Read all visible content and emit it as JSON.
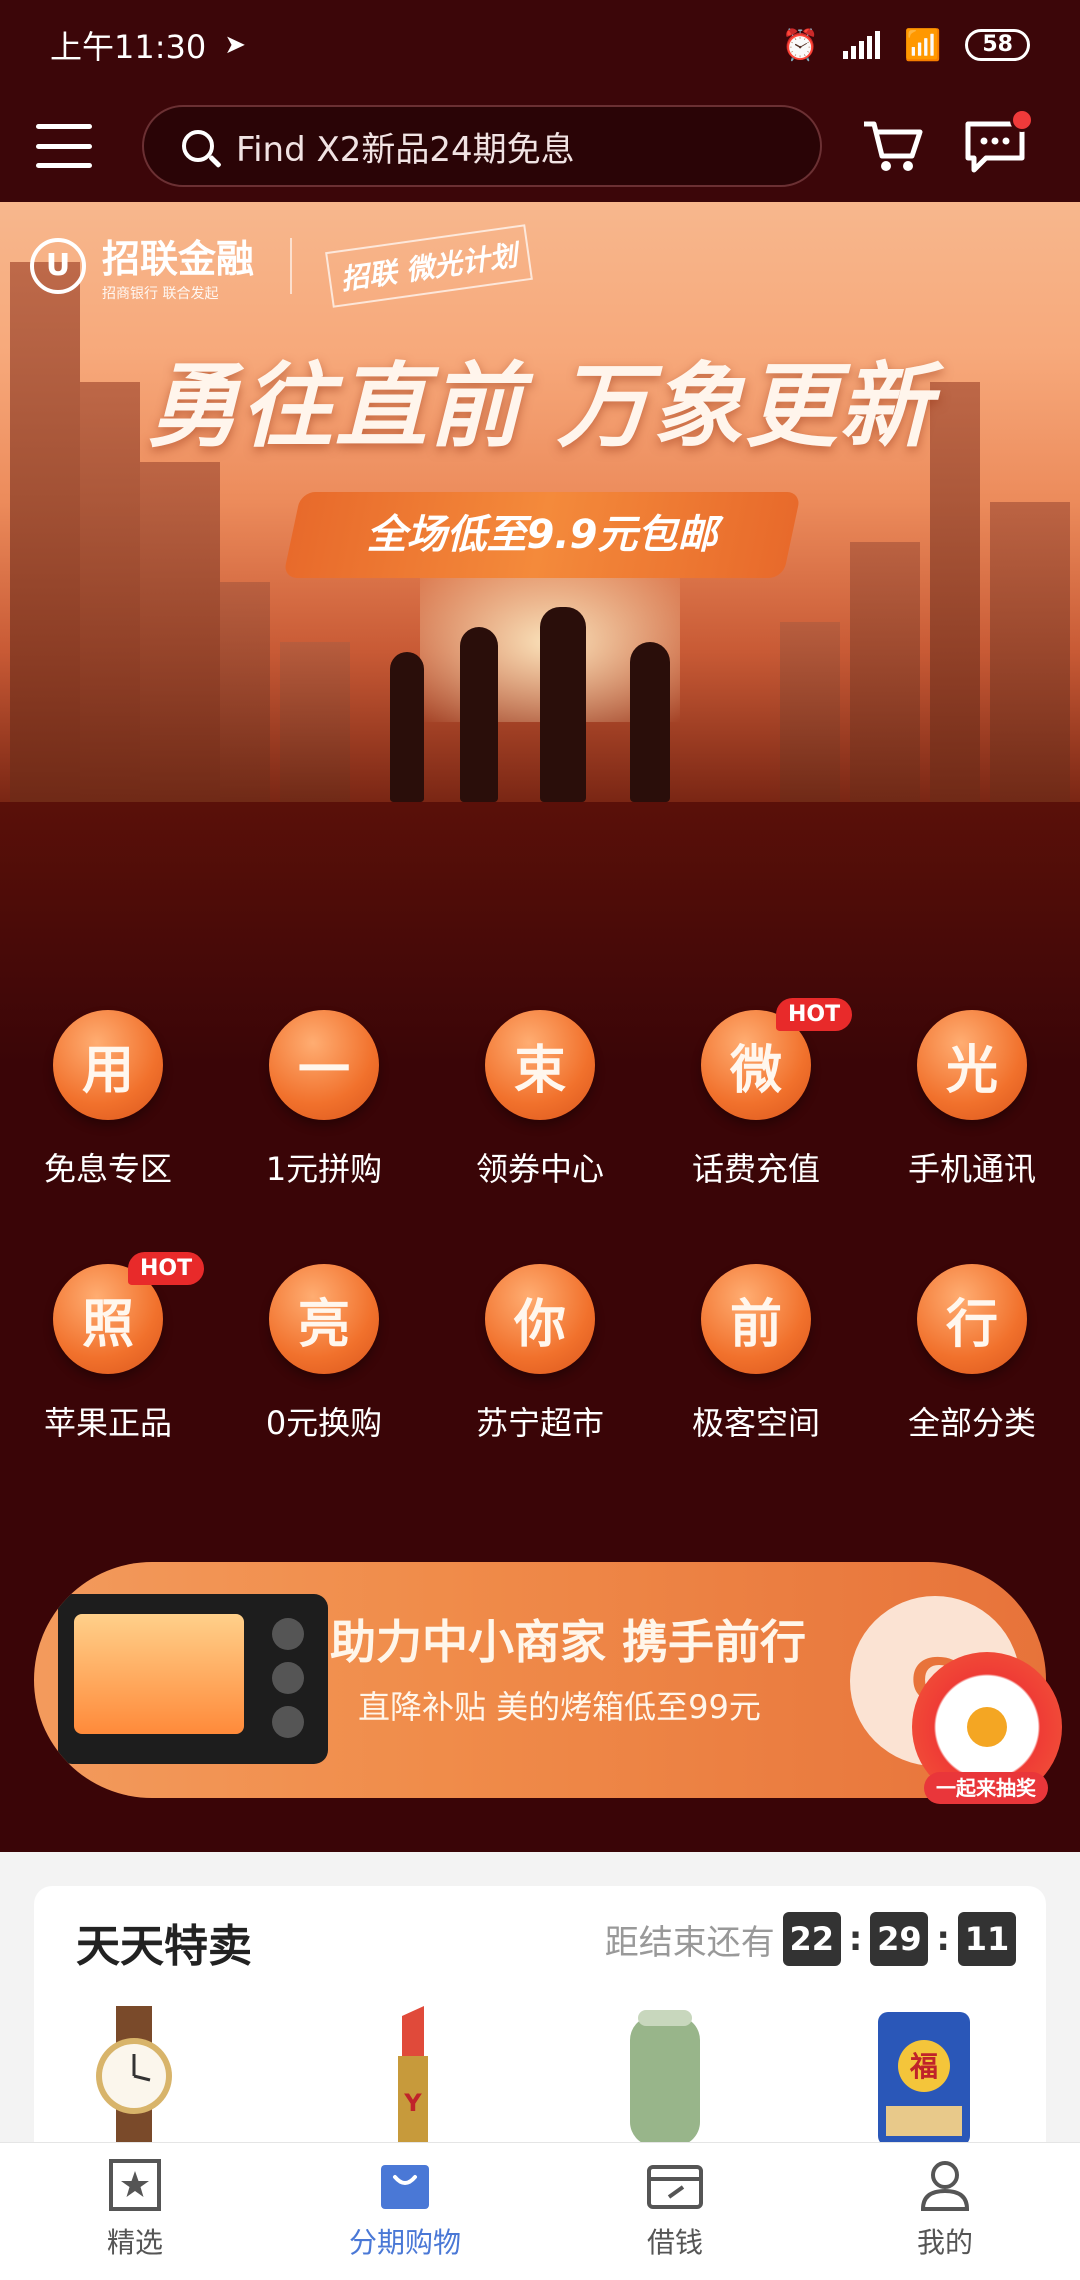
{
  "status_bar": {
    "time": "上午11:30",
    "battery": "58"
  },
  "header": {
    "search_placeholder": "Find X2新品24期免息"
  },
  "banner": {
    "brand_name": "招联金融",
    "brand_sub": "招商银行 联合发起",
    "plan": "招联 微光计划",
    "headline": "勇往直前 万象更新",
    "promo": "全场低至9.9元包邮"
  },
  "categories": [
    {
      "glyph": "用",
      "label": "免息专区",
      "hot": ""
    },
    {
      "glyph": "一",
      "label": "1元拼购",
      "hot": ""
    },
    {
      "glyph": "束",
      "label": "领券中心",
      "hot": ""
    },
    {
      "glyph": "微",
      "label": "话费充值",
      "hot": "HOT"
    },
    {
      "glyph": "光",
      "label": "手机通讯",
      "hot": ""
    },
    {
      "glyph": "照",
      "label": "苹果正品",
      "hot": "HOT"
    },
    {
      "glyph": "亮",
      "label": "0元换购",
      "hot": ""
    },
    {
      "glyph": "你",
      "label": "苏宁超市",
      "hot": ""
    },
    {
      "glyph": "前",
      "label": "极客空间",
      "hot": ""
    },
    {
      "glyph": "行",
      "label": "全部分类",
      "hot": ""
    }
  ],
  "promo_card": {
    "title": "助力中小商家 携手前行",
    "subtitle": "直降补贴 美的烤箱低至99元",
    "button": "G",
    "lottery": "一起来抽奖"
  },
  "daily_deals": {
    "title": "天天特卖",
    "countdown_label": "距结束还有",
    "hours": "22",
    "minutes": "29",
    "seconds": "11",
    "products": [
      "watch-icon",
      "lipstick-icon",
      "kettle-icon",
      "rice-bag-icon"
    ]
  },
  "bottom_nav": [
    {
      "label": "精选",
      "icon": "star-box-icon",
      "active": false
    },
    {
      "label": "分期购物",
      "icon": "shopping-bag-icon",
      "active": true
    },
    {
      "label": "借钱",
      "icon": "wallet-icon",
      "active": false
    },
    {
      "label": "我的",
      "icon": "profile-icon",
      "active": false
    }
  ],
  "colors": {
    "accent": "#f1712c",
    "nav_active": "#4a78d6",
    "background": "#3a0507",
    "hot": "#e82a2a"
  }
}
